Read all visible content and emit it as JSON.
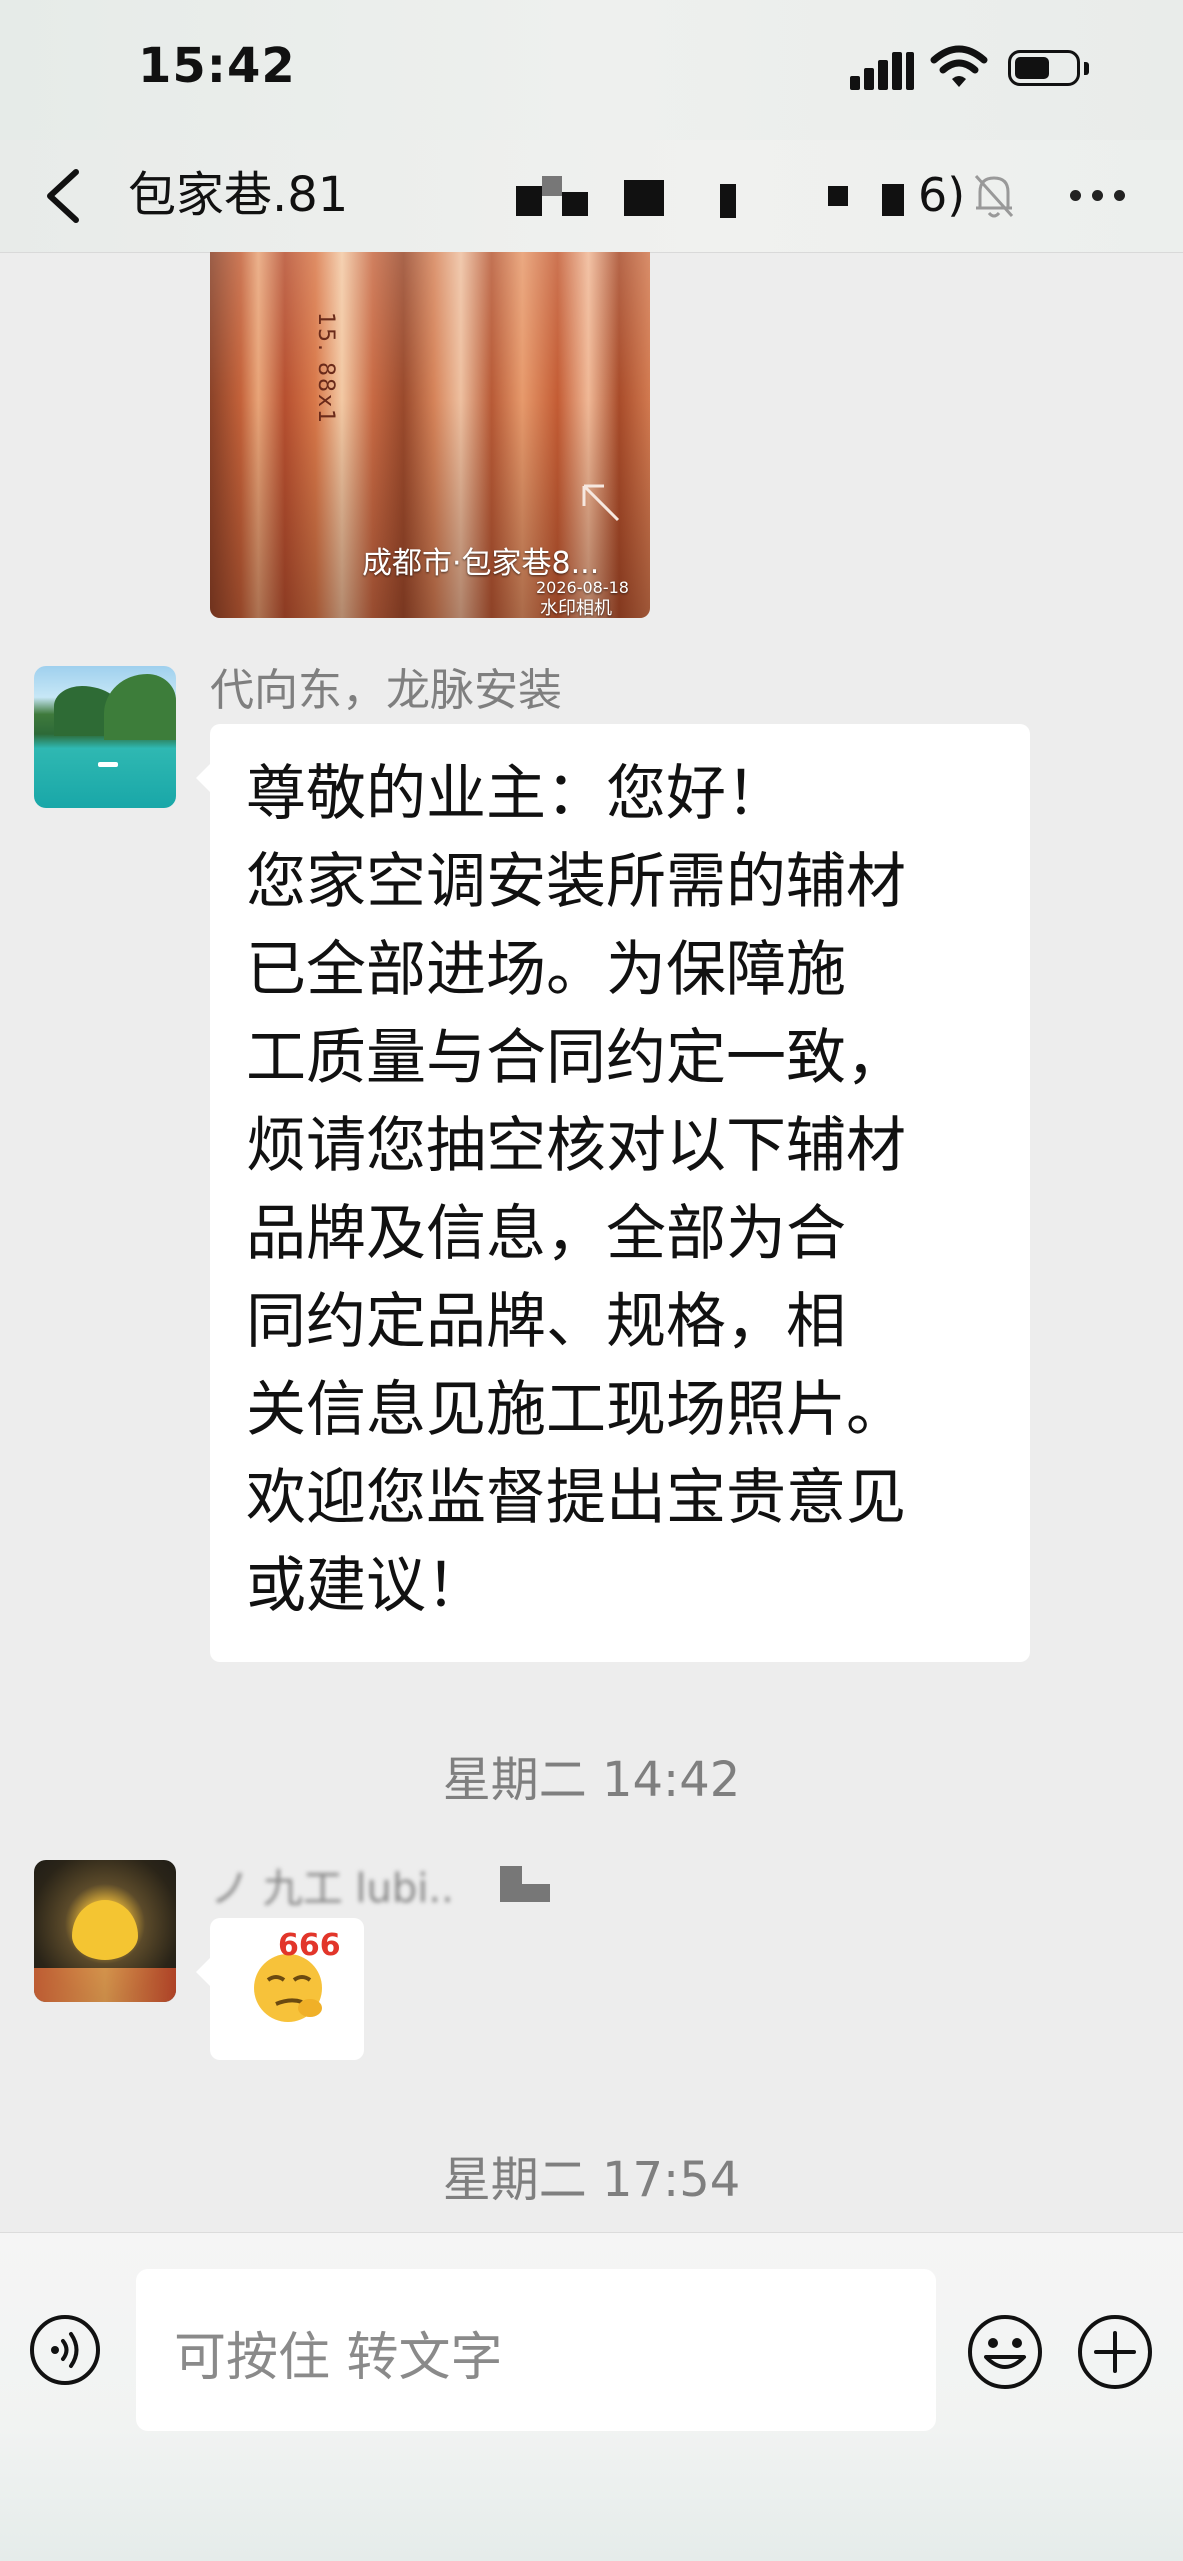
{
  "status_bar": {
    "time": "15:42"
  },
  "nav": {
    "title_visible": "包家巷.81",
    "title_tail": "6)"
  },
  "messages": {
    "photo": {
      "caption": "成都市·包家巷8...",
      "date": "2026-08-18",
      "watermark": "水印相机",
      "print_text": "15. 88x1"
    },
    "text_message": {
      "sender": "代向东，龙脉安装",
      "body": "尊敬的业主：您好！\n您家空调安装所需的辅材\n已全部进场。为保障施\n工质量与合同约定一致，\n烦请您抽空核对以下辅材\n品牌及信息，全部为合\n同约定品牌、规格，相\n关信息见施工现场照片。\n欢迎您监督提出宝贵意见\n或建议！"
    },
    "timestamp_1": "星期二 14:42",
    "emoji_message": {
      "sender": "ノ 九工 lubi..",
      "sticker_text": "666"
    },
    "timestamp_2": "星期二 17:54"
  },
  "input_bar": {
    "placeholder": "可按住 转文字"
  },
  "colors": {
    "background": "#ededed",
    "bubble": "#ffffff",
    "muted_text": "#7f7f7f"
  },
  "icons": [
    "signal-icon",
    "wifi-icon",
    "battery-icon",
    "back-arrow-icon",
    "mute-bell-icon",
    "more-dots-icon",
    "expand-icon",
    "voice-icon",
    "emoji-icon",
    "plus-icon"
  ]
}
